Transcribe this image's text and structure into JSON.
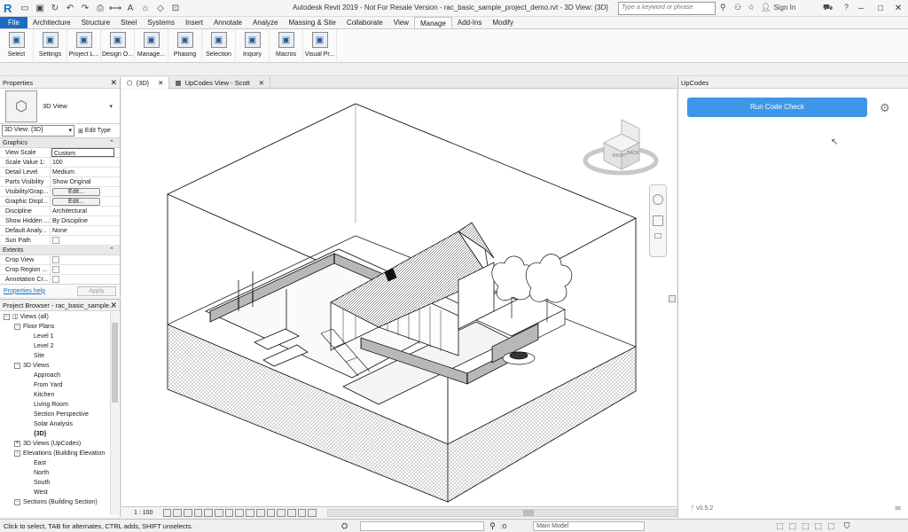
{
  "app": {
    "window_title": "Autodesk Revit 2019 - Not For Resale Version - rac_basic_sample_project_demo.rvt - 3D View: {3D}",
    "search_placeholder": "Type a keyword or phrase",
    "sign_in": "Sign In"
  },
  "menu": {
    "tabs": [
      "File",
      "Architecture",
      "Structure",
      "Steel",
      "Systems",
      "Insert",
      "Annotate",
      "Analyze",
      "Massing & Site",
      "Collaborate",
      "View",
      "Manage",
      "Add-Ins",
      "Modify"
    ],
    "active": "Manage"
  },
  "ribbon": {
    "buttons": [
      {
        "label": "Select",
        "icon": "cursor-icon"
      },
      {
        "label": "Settings",
        "icon": "settings-icon"
      },
      {
        "label": "Project L...",
        "icon": "project-location-icon"
      },
      {
        "label": "Design O...",
        "icon": "design-options-icon"
      },
      {
        "label": "Manage...",
        "icon": "manage-links-icon"
      },
      {
        "label": "Phasing",
        "icon": "phasing-icon"
      },
      {
        "label": "Selection",
        "icon": "selection-icon"
      },
      {
        "label": "Inquiry",
        "icon": "inquiry-icon"
      },
      {
        "label": "Macros",
        "icon": "macros-icon"
      },
      {
        "label": "Visual Pr...",
        "icon": "visual-programming-icon"
      }
    ]
  },
  "properties": {
    "title": "Properties",
    "type_name": "3D View",
    "view_selector": "3D View: {3D}",
    "edit_type": "Edit Type",
    "groups": [
      {
        "name": "Graphics",
        "rows": [
          {
            "name": "View Scale",
            "value": "Custom",
            "style": "boxed"
          },
          {
            "name": "Scale Value    1:",
            "value": "100"
          },
          {
            "name": "Detail Level",
            "value": "Medium"
          },
          {
            "name": "Parts Visibility",
            "value": "Show Original"
          },
          {
            "name": "Visibility/Grap...",
            "value": "Edit...",
            "style": "button"
          },
          {
            "name": "Graphic Displ...",
            "value": "Edit...",
            "style": "button"
          },
          {
            "name": "Discipline",
            "value": "Architectural"
          },
          {
            "name": "Show Hidden ...",
            "value": "By Discipline"
          },
          {
            "name": "Default Analy...",
            "value": "None"
          },
          {
            "name": "Sun Path",
            "value": "",
            "style": "checkbox"
          }
        ]
      },
      {
        "name": "Extents",
        "rows": [
          {
            "name": "Crop View",
            "value": "",
            "style": "checkbox"
          },
          {
            "name": "Crop Region ...",
            "value": "",
            "style": "checkbox"
          },
          {
            "name": "Annotation Cr...",
            "value": "",
            "style": "checkbox"
          }
        ]
      }
    ],
    "help_link": "Properties help",
    "apply": "Apply"
  },
  "project_browser": {
    "title": "Project Browser - rac_basic_sample...",
    "items": [
      {
        "label": "Views (all)",
        "level": 0,
        "toggle": "-",
        "icon": true
      },
      {
        "label": "Floor Plans",
        "level": 1,
        "toggle": "-"
      },
      {
        "label": "Level 1",
        "level": 2
      },
      {
        "label": "Level 2",
        "level": 2
      },
      {
        "label": "Site",
        "level": 2
      },
      {
        "label": "3D Views",
        "level": 1,
        "toggle": "-"
      },
      {
        "label": "Approach",
        "level": 2
      },
      {
        "label": "From Yard",
        "level": 2
      },
      {
        "label": "Kitchen",
        "level": 2
      },
      {
        "label": "Living Room",
        "level": 2
      },
      {
        "label": "Section Perspective",
        "level": 2
      },
      {
        "label": "Solar Analysis",
        "level": 2
      },
      {
        "label": "{3D}",
        "level": 2,
        "bold": true
      },
      {
        "label": "3D Views (UpCodes)",
        "level": 1,
        "toggle": "+"
      },
      {
        "label": "Elevations (Building Elevation",
        "level": 1,
        "toggle": "-"
      },
      {
        "label": "East",
        "level": 2
      },
      {
        "label": "North",
        "level": 2
      },
      {
        "label": "South",
        "level": 2
      },
      {
        "label": "West",
        "level": 2
      },
      {
        "label": "Sections (Building Section)",
        "level": 1,
        "toggle": "-"
      }
    ]
  },
  "view_tabs": [
    {
      "label": "{3D}",
      "active": true
    },
    {
      "label": "UpCodes View - Scott",
      "active": false
    }
  ],
  "viewcube": {
    "right": "RIGHT",
    "back": "BACK"
  },
  "view_scale": "1 : 100",
  "upcodes": {
    "title": "UpCodes",
    "run_button": "Run Code Check",
    "version": "v0.5.2",
    "accent": "#3d96e8"
  },
  "status": {
    "hint": "Click to select, TAB for alternates, CTRL adds, SHIFT unselects.",
    "zero": ":0",
    "model": "Main Model"
  }
}
